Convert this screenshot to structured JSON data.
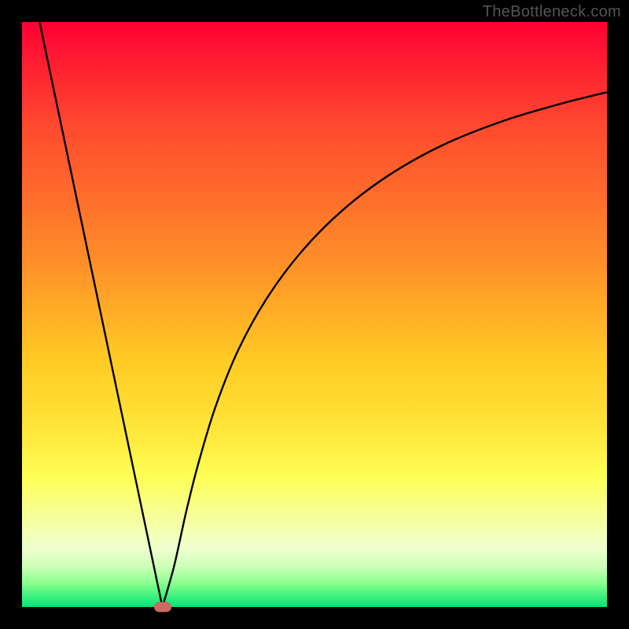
{
  "watermark": "TheBottleneck.com",
  "chart_data": {
    "type": "line",
    "title": "",
    "xlabel": "",
    "ylabel": "",
    "xlim": [
      0,
      100
    ],
    "ylim": [
      0,
      100
    ],
    "grid": false,
    "series": [
      {
        "name": "left-branch",
        "x": [
          3,
          24
        ],
        "y": [
          100,
          0
        ]
      },
      {
        "name": "right-branch",
        "x": [
          24,
          26,
          28,
          30,
          33,
          37,
          42,
          48,
          55,
          63,
          72,
          82,
          92,
          100
        ],
        "y": [
          0,
          7,
          16,
          24,
          34,
          44,
          53,
          61,
          68,
          74,
          79,
          83,
          86,
          88
        ]
      }
    ],
    "annotations": [
      {
        "name": "vertex-marker",
        "x": 24,
        "y": 0
      }
    ],
    "background_gradient_stops": [
      {
        "pos": 0.0,
        "color": "#ff0033"
      },
      {
        "pos": 0.4,
        "color": "#ff8b29"
      },
      {
        "pos": 0.78,
        "color": "#feff55"
      },
      {
        "pos": 1.0,
        "color": "#00e676"
      }
    ]
  }
}
